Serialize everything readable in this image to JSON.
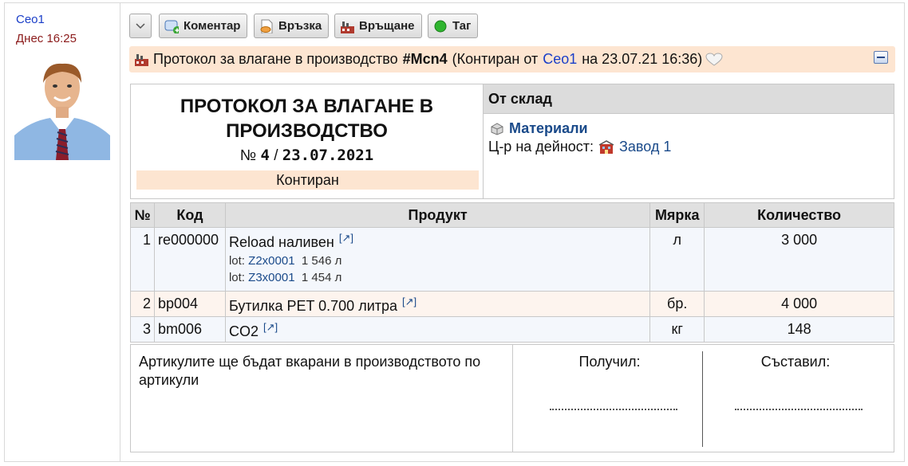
{
  "user": {
    "name": "Ceo1",
    "time": "Днес 16:25"
  },
  "toolbar": {
    "comment_label": "Коментар",
    "link_label": "Връзка",
    "return_label": "Връщане",
    "tag_label": "Таг"
  },
  "docbar": {
    "prefix": "Протокол за влагане в производство",
    "handle": "#Mcn4",
    "status_open": "(Контиран от",
    "user": "Ceo1",
    "on": "на 23.07.21 16:36)"
  },
  "header": {
    "title_line1": "ПРОТОКОЛ ЗА ВЛАГАНЕ В",
    "title_line2": "ПРОИЗВОДСТВО",
    "num_prefix": "№",
    "num": "4",
    "sep": "/",
    "date": "23.07.2021",
    "state": "Контиран"
  },
  "store": {
    "heading": "От склад",
    "name": "Материали",
    "center_label": "Ц-р на дейност:",
    "center_value": "Завод 1"
  },
  "table": {
    "headers": [
      "№",
      "Код",
      "Продукт",
      "Мярка",
      "Количество"
    ],
    "rows": [
      {
        "n": "1",
        "code": "re000000",
        "product": "Reload наливен",
        "ext": "[↗]",
        "lots": [
          {
            "label": "lot:",
            "batch": "Z2x0001",
            "qty": "1 546 л"
          },
          {
            "label": "lot:",
            "batch": "Z3x0001",
            "qty": "1 454 л"
          }
        ],
        "unit": "л",
        "qty": "3 000"
      },
      {
        "n": "2",
        "code": "bp004",
        "product": "Бутилка PET 0.700 литра",
        "ext": "[↗]",
        "unit": "бр.",
        "qty": "4 000"
      },
      {
        "n": "3",
        "code": "bm006",
        "product": "CO2",
        "ext": "[↗]",
        "unit": "кг",
        "qty": "148"
      }
    ]
  },
  "footer": {
    "note": "Артикулите ще бъдат вкарани в производството по артикули",
    "received": "Получил:",
    "composed": "Съставил:"
  },
  "colors": {
    "accent_bg": "#fde5d1",
    "link": "#1a3ec8",
    "time": "#8b1a1a"
  }
}
